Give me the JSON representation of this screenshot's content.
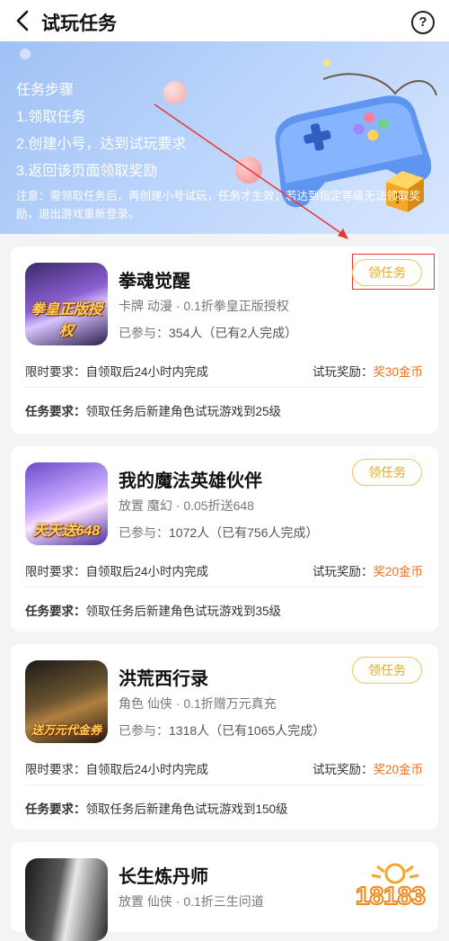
{
  "header": {
    "title": "试玩任务",
    "help_glyph": "?"
  },
  "banner": {
    "heading": "任务步骤",
    "step1": "1.领取任务",
    "step2": "2.创建小号，达到试玩要求",
    "step3": "3.返回该页面领取奖励",
    "note": "注意：需领取任务后，再创建小号试玩，任务才生效；若达到指定等级无法领取奖励，退出游戏重新登录。"
  },
  "labels": {
    "joined_prefix": "已参与：",
    "limit": "限时要求：自领取后24小时内完成",
    "reward_label": "试玩奖励：",
    "task_req_label": "任务要求：",
    "claim_button": "领任务"
  },
  "tasks": [
    {
      "name": "拳魂觉醒",
      "tags": "卡牌 动漫 · 0.1折拳皇正版授权",
      "joined": "354人（已有2人完成）",
      "reward": "奖30金币",
      "requirement": "领取任务后新建角色试玩游戏到25级",
      "icon_caption": "拳皇正版授权"
    },
    {
      "name": "我的魔法英雄伙伴",
      "tags": "放置 魔幻 · 0.05折送648",
      "joined": "1072人（已有756人完成）",
      "reward": "奖20金币",
      "requirement": "领取任务后新建角色试玩游戏到35级",
      "icon_caption": "天天送648"
    },
    {
      "name": "洪荒西行录",
      "tags": "角色 仙侠 · 0.1折赠万元真充",
      "joined": "1318人（已有1065人完成）",
      "reward": "奖20金币",
      "requirement": "领取任务后新建角色试玩游戏到150级",
      "icon_caption": "送万元代金券"
    },
    {
      "name": "长生炼丹师",
      "tags": "放置 仙侠 · 0.1折三生问道"
    }
  ],
  "watermark": "18183",
  "colors": {
    "accent": "#e8a91c",
    "reward": "#f0701d",
    "highlight": "#e53935",
    "banner": "#b9d3fb"
  }
}
